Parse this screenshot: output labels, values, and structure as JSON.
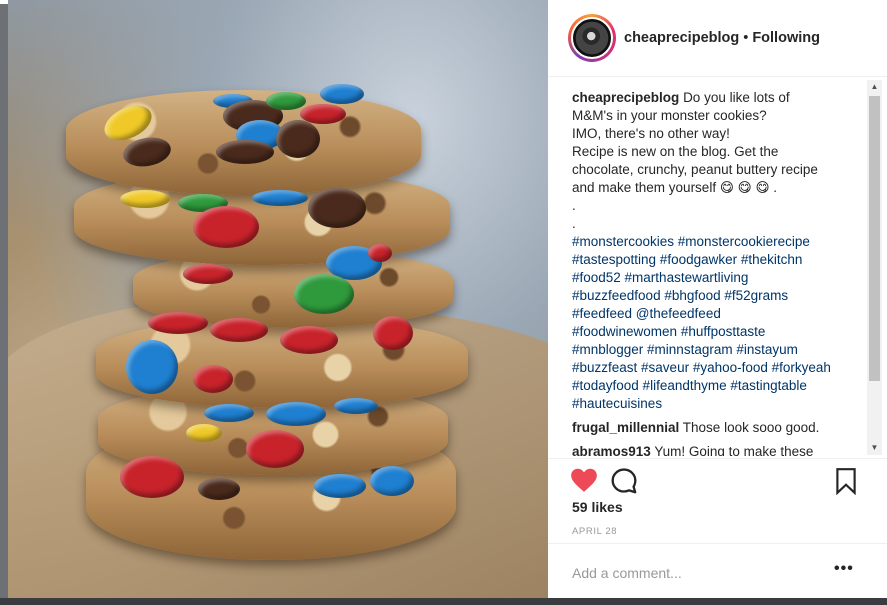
{
  "post": {
    "username": "cheaprecipeblog",
    "separator": "•",
    "follow_state": "Following",
    "caption_lines": [
      "Do you like lots of",
      "M&M's in your monster cookies?",
      "IMO, there's no other way!",
      "Recipe is new on the blog. Get the",
      "chocolate, crunchy, peanut buttery recipe",
      "and make them yourself 😋 😋 😋 .",
      ".",
      "."
    ],
    "hashtag_lines": [
      "#monstercookies #monstercookierecipe",
      "#tastespotting #foodgawker #thekitchn",
      "#food52 #marthastewartliving",
      "#buzzfeedfood #bhgfood #f52grams",
      "#feedfeed @thefeedfeed",
      "#foodwinewomen #huffposttaste",
      "#mnblogger #minnstagram #instayum",
      "#buzzfeast #saveur #yahoo-food #forkyeah",
      "#todayfood #lifeandthyme #tastingtable",
      "#hautecuisines"
    ],
    "comments": [
      {
        "user": "frugal_millennial",
        "text": "Those look sooo good."
      },
      {
        "user": "abramos913",
        "text": "Yum! Going to make these"
      }
    ],
    "likes": "59 likes",
    "date": "APRIL 28",
    "add_comment_placeholder": "Add a comment...",
    "more_label": "•••"
  },
  "icons": {
    "heart": "heart-icon",
    "comment": "comment-icon",
    "bookmark": "bookmark-icon",
    "more": "more-options-icon"
  },
  "colors": {
    "like_red": "#ed4956",
    "hashtag_blue": "#003569",
    "muted_gray": "#999999"
  }
}
